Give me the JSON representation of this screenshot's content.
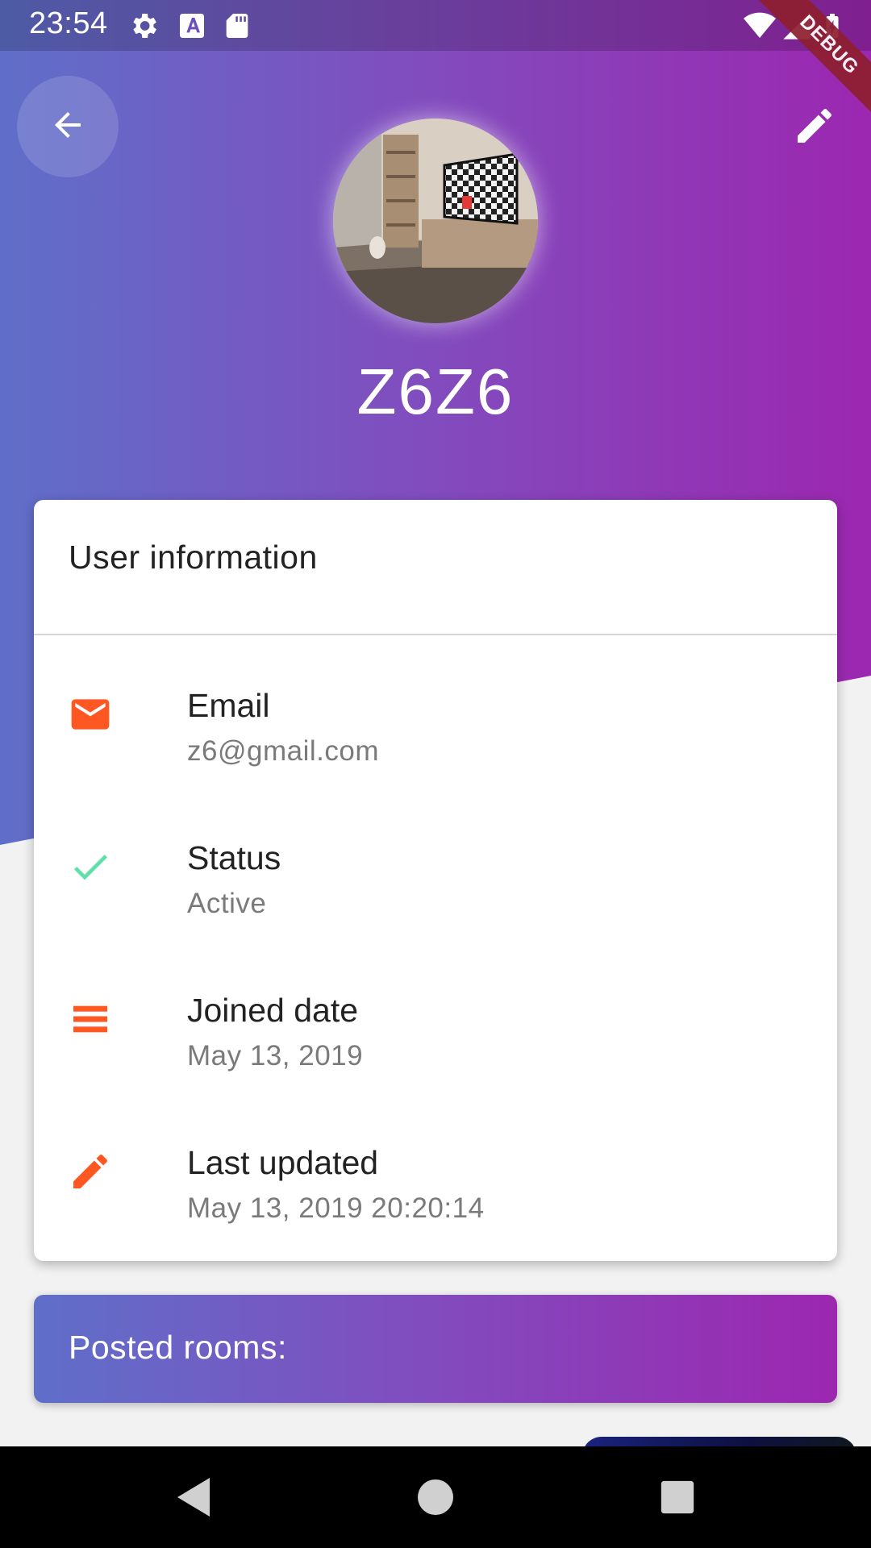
{
  "status_bar": {
    "time": "23:54",
    "icons": [
      "gear-icon",
      "a-letter-icon",
      "sd-card-icon",
      "wifi-icon",
      "signal-icon",
      "battery-charging-icon"
    ],
    "debug_label": "DEBUG"
  },
  "header": {
    "back_icon": "arrow-back-icon",
    "edit_icon": "pencil-icon",
    "username": "Z6Z6"
  },
  "colors": {
    "gradient_start": "#5f6fc9",
    "gradient_end": "#9c27b0",
    "icon_accent": "#ff5722",
    "status_accent": "#5fe0a8"
  },
  "user_info": {
    "title": "User information",
    "rows": [
      {
        "icon": "email-icon",
        "label": "Email",
        "value": "z6@gmail.com"
      },
      {
        "icon": "check-icon",
        "label": "Status",
        "value": "Active"
      },
      {
        "icon": "calendar-lines-icon",
        "label": "Joined date",
        "value": "May 13, 2019"
      },
      {
        "icon": "pencil-icon",
        "label": "Last updated",
        "value": "May 13, 2019 20:20:14"
      }
    ]
  },
  "posted_rooms": {
    "label": "Posted rooms:"
  },
  "nav": {
    "back": "triangle-back-icon",
    "home": "circle-home-icon",
    "recents": "square-recents-icon"
  }
}
